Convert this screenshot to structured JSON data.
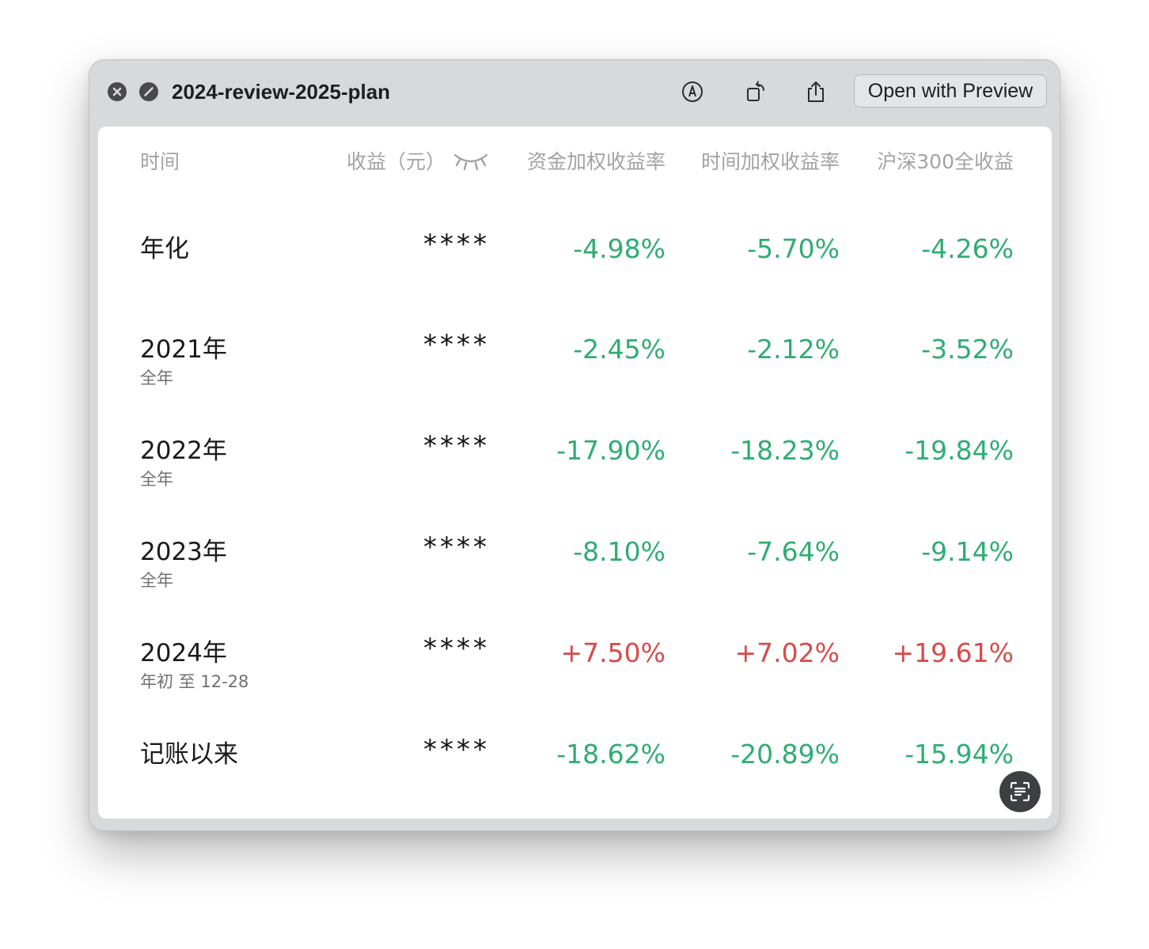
{
  "window": {
    "title": "2024-review-2025-plan",
    "open_with_preview_label": "Open with Preview"
  },
  "icons": {
    "close": "close-icon",
    "hide": "slash-circle-icon",
    "markup": "markup-pen-icon",
    "rotate": "rotate-icon",
    "share": "share-icon",
    "eye": "eye-closed-icon",
    "live_text": "live-text-scan-icon"
  },
  "colors": {
    "negative": "#2fad72",
    "positive": "#d94a4a",
    "header_text": "#a3a3a3"
  },
  "table": {
    "headers": {
      "time": "时间",
      "earnings": "收益（元）",
      "money_weighted": "资金加权收益率",
      "time_weighted": "时间加权收益率",
      "csi300": "沪深300全收益"
    },
    "rows": [
      {
        "label": "年化",
        "sub": "",
        "earnings": "****",
        "money_weighted": "-4.98%",
        "time_weighted": "-5.70%",
        "csi300": "-4.26%",
        "tone": "negative"
      },
      {
        "label": "2021年",
        "sub": "全年",
        "earnings": "****",
        "money_weighted": "-2.45%",
        "time_weighted": "-2.12%",
        "csi300": "-3.52%",
        "tone": "negative"
      },
      {
        "label": "2022年",
        "sub": "全年",
        "earnings": "****",
        "money_weighted": "-17.90%",
        "time_weighted": "-18.23%",
        "csi300": "-19.84%",
        "tone": "negative"
      },
      {
        "label": "2023年",
        "sub": "全年",
        "earnings": "****",
        "money_weighted": "-8.10%",
        "time_weighted": "-7.64%",
        "csi300": "-9.14%",
        "tone": "negative"
      },
      {
        "label": "2024年",
        "sub": "年初 至 12-28",
        "earnings": "****",
        "money_weighted": "+7.50%",
        "time_weighted": "+7.02%",
        "csi300": "+19.61%",
        "tone": "positive"
      },
      {
        "label": "记账以来",
        "sub": "",
        "earnings": "****",
        "money_weighted": "-18.62%",
        "time_weighted": "-20.89%",
        "csi300": "-15.94%",
        "tone": "negative"
      }
    ]
  }
}
